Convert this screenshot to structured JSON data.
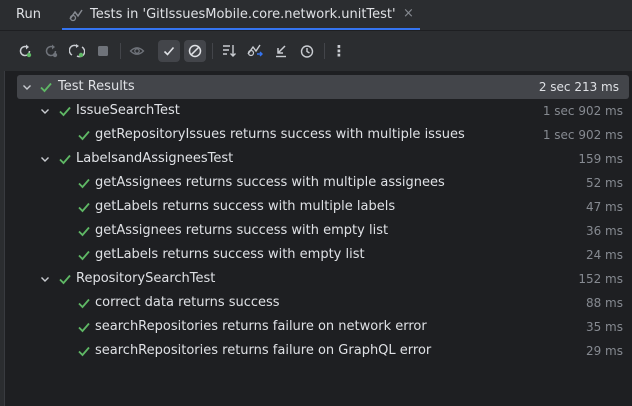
{
  "header": {
    "run_label": "Run",
    "tab_title": "Tests in 'GitIssuesMobile.core.network.unitTest'",
    "tab_close": "×"
  },
  "toolbar": {
    "more": "⋮"
  },
  "tree": {
    "root": {
      "label": "Test Results",
      "time": "2 sec 213 ms"
    },
    "issue_search": {
      "label": "IssueSearchTest",
      "time": "1 sec 902 ms",
      "tests": [
        {
          "label": "getRepositoryIssues returns success with multiple issues",
          "time": "1 sec 902 ms"
        }
      ]
    },
    "labels_assignees": {
      "label": "LabelsandAssigneesTest",
      "time": "159 ms",
      "tests": [
        {
          "label": "getAssignees returns success with multiple assignees",
          "time": "52 ms"
        },
        {
          "label": "getLabels returns success with multiple labels",
          "time": "47 ms"
        },
        {
          "label": "getAssignees returns success with empty list",
          "time": "36 ms"
        },
        {
          "label": "getLabels returns success with empty list",
          "time": "24 ms"
        }
      ]
    },
    "repository_search": {
      "label": "RepositorySearchTest",
      "time": "152 ms",
      "tests": [
        {
          "label": "correct data returns success",
          "time": "88 ms"
        },
        {
          "label": "searchRepositories returns failure on network error",
          "time": "35 ms"
        },
        {
          "label": "searchRepositories returns failure on GraphQL error",
          "time": "29 ms"
        }
      ]
    }
  },
  "colors": {
    "pass": "#5fb865",
    "accent": "#3574f0",
    "background": "#1e1f22",
    "toolbar": "#2b2d30"
  }
}
